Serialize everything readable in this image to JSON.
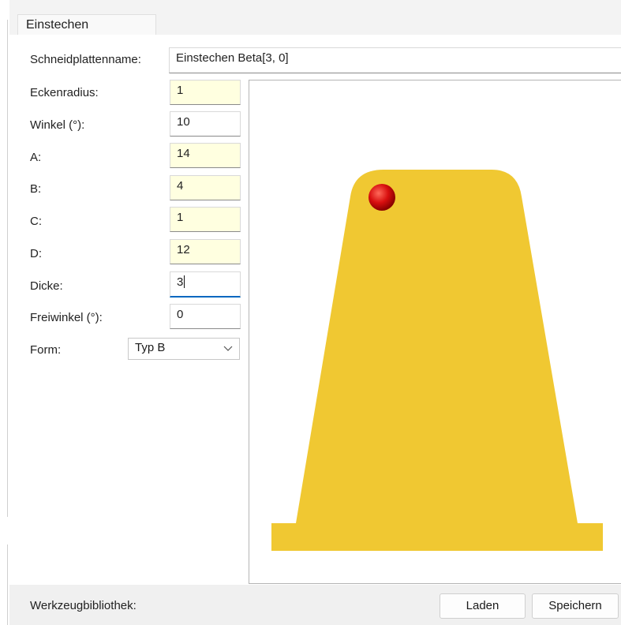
{
  "tab": {
    "label": "Einstechen"
  },
  "form": {
    "name_label": "Schneidplattenname:",
    "name_value": "Einstechen Beta[3, 0]",
    "fields": [
      {
        "label": "Eckenradius:",
        "value": "1"
      },
      {
        "label": "Winkel (°):",
        "value": "10"
      },
      {
        "label": "A:",
        "value": "14"
      },
      {
        "label": "B:",
        "value": "4"
      },
      {
        "label": "C:",
        "value": "1"
      },
      {
        "label": "D:",
        "value": "12"
      },
      {
        "label": "Dicke:",
        "value": "3"
      },
      {
        "label": "Freiwinkel  (°):",
        "value": "0"
      }
    ],
    "form_label": "Form:",
    "form_value": "Typ B"
  },
  "footer": {
    "library_label": "Werkzeugbibliothek:",
    "load_label": "Laden",
    "save_label": "Speichern"
  },
  "colors": {
    "insert_fill": "#f0c832",
    "marker": "#cc0000",
    "field_highlight": "#ffffe0",
    "focus_accent": "#0067c0"
  },
  "icons": {
    "dropdown": "chevron-down-icon",
    "reference_point": "reference-point-icon"
  }
}
